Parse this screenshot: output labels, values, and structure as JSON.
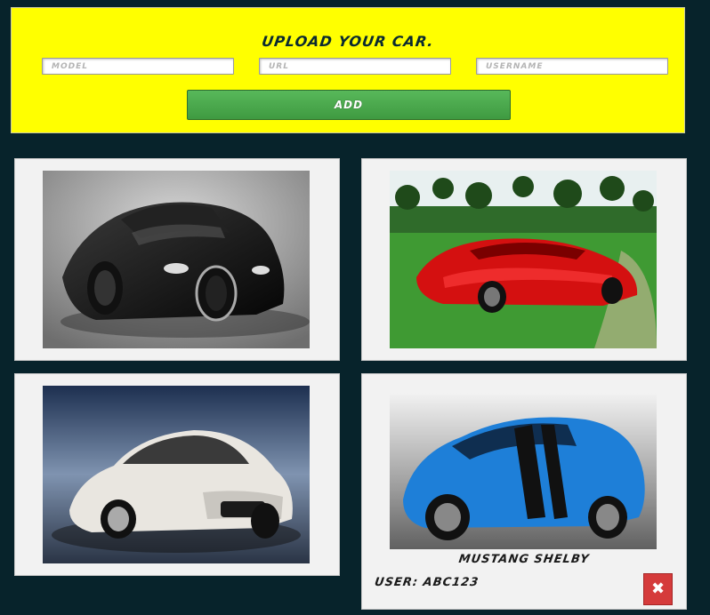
{
  "upload": {
    "title": "Upload your car.",
    "fields": [
      {
        "placeholder": "Model"
      },
      {
        "placeholder": "URL"
      },
      {
        "placeholder": "Username"
      }
    ],
    "add_label": "Add"
  },
  "cars": [
    {
      "image": "black-bugatti-veyron"
    },
    {
      "image": "red-concept-roadster"
    },
    {
      "image": "white-maserati-ghibli"
    },
    {
      "image": "blue-mustang-shelby",
      "name": "Mustang Shelby",
      "user": "User: abc123",
      "delete_icon": "close-icon",
      "delete_label": "✖"
    }
  ]
}
